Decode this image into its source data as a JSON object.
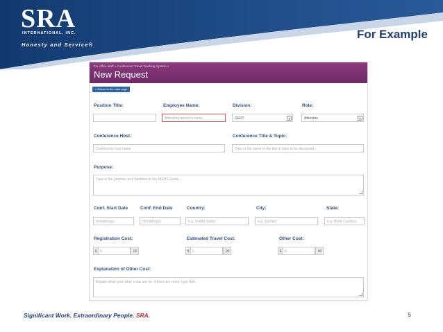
{
  "slide": {
    "logo": "SRA",
    "logo_sub": "INTERNATIONAL, INC.",
    "tagline": "Honesty and Service®",
    "title": "For Example",
    "footer_prefix": "Significant Work. Extraordinary People.",
    "footer_brand": "SRA",
    "footer_suffix": ".",
    "page_number": "5"
  },
  "colors": {
    "header_blue": "#1f3f77",
    "form_header_purple": "#7d3372",
    "button_blue": "#2f63a8",
    "label_blue": "#2f4f7f",
    "brand_red": "#c0272d"
  },
  "form": {
    "breadcrumb": "For office staff » Conference Travel Tracking System »",
    "title": "New Request",
    "return_button": "« Return to the main page",
    "labels": {
      "position_title": "Position Title:",
      "employee_name": "Employee Name:",
      "division": "Division:",
      "role": "Role:",
      "conference_host": "Conference Host:",
      "conference_title_topic": "Conference Title & Topic:",
      "purpose": "Purpose:",
      "conf_start_date": "Conf. Start Date",
      "conf_end_date": "Conf. End Date",
      "country": "Country:",
      "city": "City:",
      "state": "State:",
      "registration_cost": "Registration Cost:",
      "estimated_travel_cost": "Estimated Travel Cost:",
      "other_cost": "Other Cost:",
      "explanation_other_cost": "Explanation of Other Cost:"
    },
    "placeholders": {
      "employee_name": "Attending person's name",
      "conference_host": "Conference host name",
      "conference_title_topic": "Type in the name of the title & topic to be discussed...",
      "purpose": "Type in the purpose as it fatalities to the NIEHS Goals...",
      "conf_start_date": "mm/dd/yyyy",
      "conf_end_date": "mm/dd/yyyy",
      "country": "e.g. United States",
      "city": "e.g. Durham",
      "state": "e.g. North Carolina",
      "explanation_other_cost": "Explain what your other costs are for. If there are none, type N/A."
    },
    "values": {
      "division": "DERT",
      "role": "Attendee"
    },
    "money": {
      "prefix": "$",
      "amount": "0",
      "suffix": ".00"
    }
  }
}
